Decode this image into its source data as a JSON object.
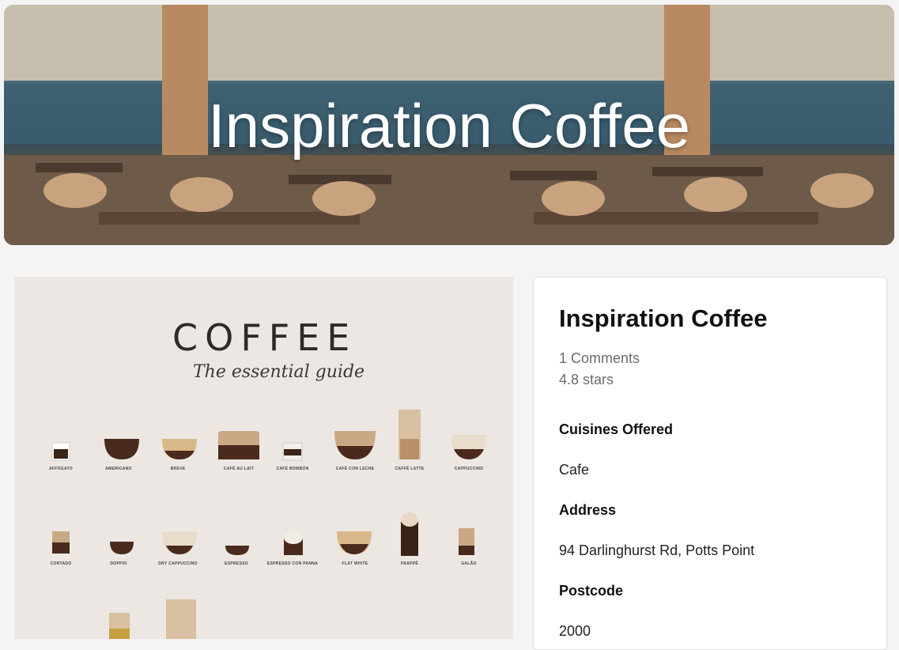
{
  "hero": {
    "title": "Inspiration Coffee"
  },
  "poster": {
    "title": "COFFEE",
    "subtitle": "The essential guide",
    "drinks_row1": [
      "AFFOGATO",
      "AMERICANO",
      "BREVE",
      "CAFÉ AU LAIT",
      "CAFÉ BOMBÓN",
      "CAFÉ CON LECHE",
      "CAFFÈ LATTE",
      "CAPPUCCINO"
    ],
    "drinks_row2": [
      "CORTADO",
      "DOPPIO",
      "DRY CAPPUCCINO",
      "ESPRESSO",
      "ESPRESSO CON PANNA",
      "FLAT WHITE",
      "FRAPPÉ",
      "GALÃO"
    ]
  },
  "listing": {
    "name": "Inspiration Coffee",
    "comments": "1 Comments",
    "rating": "4.8 stars",
    "cuisines_label": "Cuisines Offered",
    "cuisines_value": "Cafe",
    "address_label": "Address",
    "address_value": "94 Darlinghurst Rd, Potts Point",
    "postcode_label": "Postcode",
    "postcode_value": "2000"
  }
}
